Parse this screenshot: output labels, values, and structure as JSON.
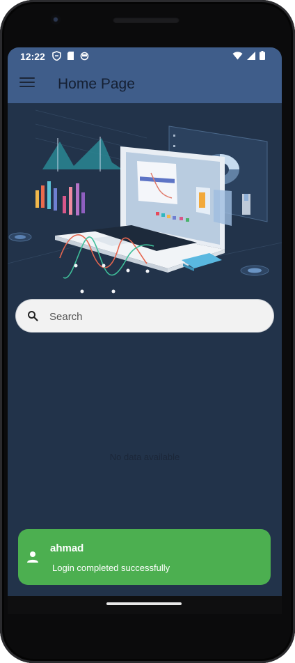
{
  "status_bar": {
    "time": "12:22"
  },
  "app_bar": {
    "title": "Home Page"
  },
  "search": {
    "placeholder": "Search"
  },
  "content": {
    "empty_message": "No data available"
  },
  "toast": {
    "title": "ahmad",
    "message": "Login completed successfully"
  },
  "colors": {
    "app_bar": "#3f5d8a",
    "background": "#22334a",
    "toast": "#4caf50"
  }
}
